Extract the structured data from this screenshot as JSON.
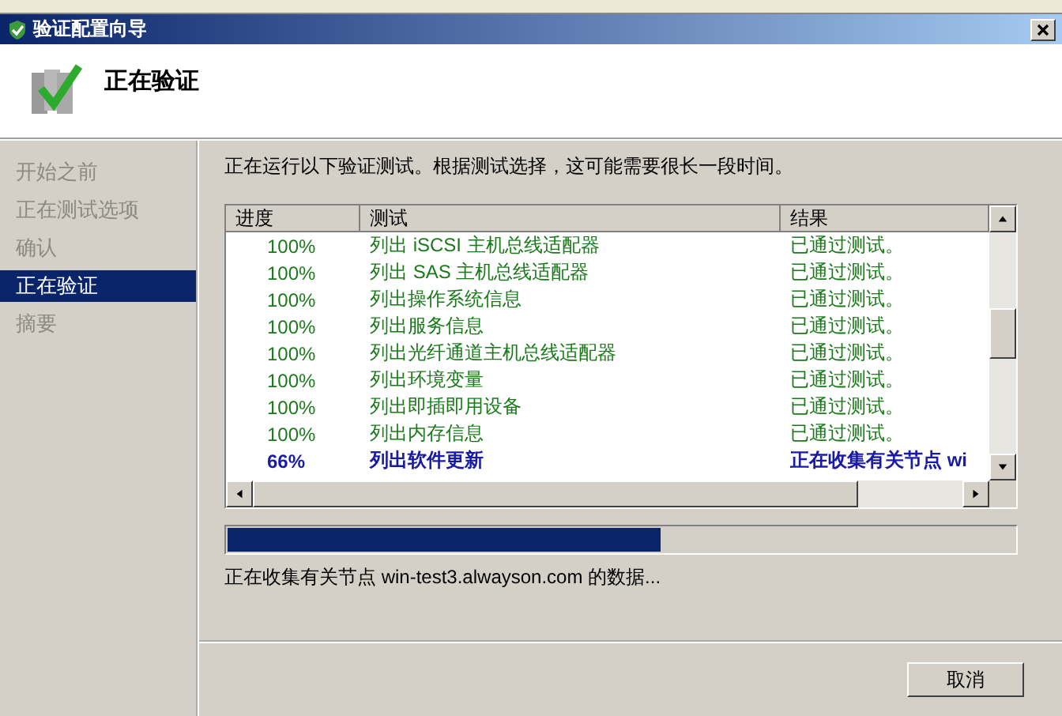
{
  "window": {
    "title": "验证配置向导"
  },
  "header": {
    "title": "正在验证"
  },
  "sidebar": {
    "items": [
      {
        "label": "开始之前",
        "selected": false
      },
      {
        "label": "正在测试选项",
        "selected": false
      },
      {
        "label": "确认",
        "selected": false
      },
      {
        "label": "正在验证",
        "selected": true
      },
      {
        "label": "摘要",
        "selected": false
      }
    ]
  },
  "intro": "正在运行以下验证测试。根据测试选择，这可能需要很长一段时间。",
  "table": {
    "columns": [
      "进度",
      "测试",
      "结果"
    ],
    "rows": [
      {
        "kind": "done",
        "progress": "100%",
        "test": "列出 iSCSI 主机总线适配器",
        "result": "已通过测试。"
      },
      {
        "kind": "done",
        "progress": "100%",
        "test": "列出 SAS 主机总线适配器",
        "result": "已通过测试。"
      },
      {
        "kind": "done",
        "progress": "100%",
        "test": "列出操作系统信息",
        "result": "已通过测试。"
      },
      {
        "kind": "done",
        "progress": "100%",
        "test": "列出服务信息",
        "result": "已通过测试。"
      },
      {
        "kind": "done",
        "progress": "100%",
        "test": "列出光纤通道主机总线适配器",
        "result": "已通过测试。"
      },
      {
        "kind": "done",
        "progress": "100%",
        "test": "列出环境变量",
        "result": "已通过测试。"
      },
      {
        "kind": "done",
        "progress": "100%",
        "test": "列出即插即用设备",
        "result": "已通过测试。"
      },
      {
        "kind": "done",
        "progress": "100%",
        "test": "列出内存信息",
        "result": "已通过测试。"
      },
      {
        "kind": "running",
        "progress": "66%",
        "test": "列出软件更新",
        "result": "正在收集有关节点 wi"
      }
    ]
  },
  "progress": {
    "level": 0.55
  },
  "status": "正在收集有关节点 win-test3.alwayson.com 的数据...",
  "buttons": [
    "取消"
  ]
}
